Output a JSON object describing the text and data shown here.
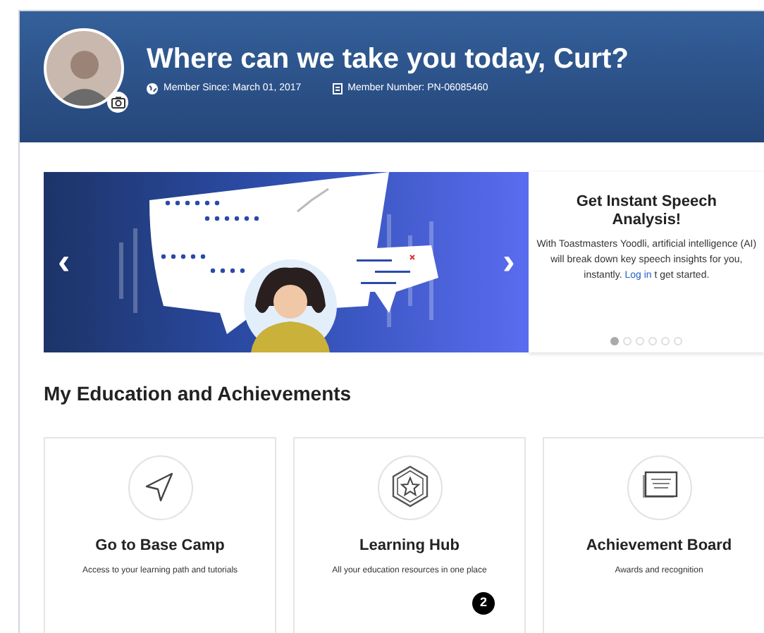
{
  "header": {
    "title": "Where can we take you today, Curt?",
    "member_since": "Member Since: March 01, 2017",
    "member_number": "Member Number: PN-06085460"
  },
  "carousel": {
    "prev": "‹",
    "next": "›",
    "promo": {
      "title": "Get Instant Speech Analysis!",
      "body": "With Toastmasters Yoodli, artificial intelligence (AI) will break down key speech insights for you, instantly.",
      "link": "Log in",
      "body_after": "t",
      "body_end": "get started."
    },
    "dots": [
      {
        "selected": true
      },
      {
        "selected": false
      },
      {
        "selected": false
      },
      {
        "selected": false
      },
      {
        "selected": false
      },
      {
        "selected": false
      }
    ]
  },
  "section": {
    "title": "My Education and Achievements"
  },
  "cards": [
    {
      "kind": "arrow",
      "title": "Go to Base Camp",
      "description": "Access to your learning path and tutorials"
    },
    {
      "kind": "star",
      "title": "Learning Hub",
      "description": "All your education resources in one place",
      "badge": "2"
    },
    {
      "kind": "certificate",
      "title": "Achievement Board",
      "description": "Awards and recognition"
    }
  ]
}
